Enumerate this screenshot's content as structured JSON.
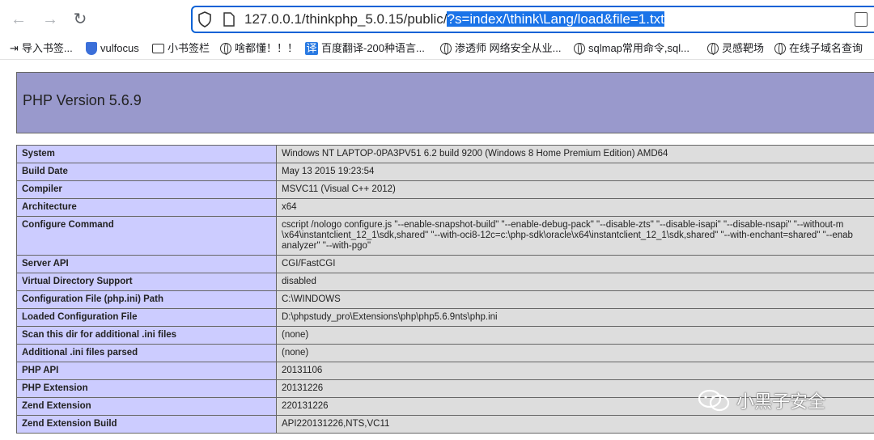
{
  "browser": {
    "url_plain": "127.0.0.1/thinkphp_5.0.15/public/",
    "url_selected": "?s=index/\\think\\Lang/load&file=1.txt"
  },
  "bookmarks": [
    {
      "label": "导入书签...",
      "icon": "import-icon"
    },
    {
      "label": "vulfocus",
      "icon": "shield-icon"
    },
    {
      "label": "小书签栏",
      "icon": "folder-icon"
    },
    {
      "label": "啥都懂！！！",
      "icon": "globe-icon"
    },
    {
      "label": "百度翻译-200种语言...",
      "icon": "translate-icon"
    },
    {
      "label": "渗透师 网络安全从业...",
      "icon": "globe-icon"
    },
    {
      "label": "sqlmap常用命令,sql...",
      "icon": "globe-icon"
    },
    {
      "label": "灵感靶场",
      "icon": "globe-icon"
    },
    {
      "label": "在线子域名查询",
      "icon": "globe-icon"
    }
  ],
  "phpinfo": {
    "title": "PHP Version 5.6.9",
    "rows": [
      {
        "key": "System",
        "value": "Windows NT LAPTOP-0PA3PV51 6.2 build 9200 (Windows 8 Home Premium Edition) AMD64"
      },
      {
        "key": "Build Date",
        "value": "May 13 2015 19:23:54"
      },
      {
        "key": "Compiler",
        "value": "MSVC11 (Visual C++ 2012)"
      },
      {
        "key": "Architecture",
        "value": "x64"
      },
      {
        "key": "Configure Command",
        "value_lines": [
          "cscript /nologo configure.js \"--enable-snapshot-build\" \"--enable-debug-pack\" \"--disable-zts\" \"--disable-isapi\" \"--disable-nsapi\" \"--without-m",
          "\\x64\\instantclient_12_1\\sdk,shared\" \"--with-oci8-12c=c:\\php-sdk\\oracle\\x64\\instantclient_12_1\\sdk,shared\" \"--with-enchant=shared\" \"--enab",
          "analyzer\" \"--with-pgo\""
        ]
      },
      {
        "key": "Server API",
        "value": "CGI/FastCGI"
      },
      {
        "key": "Virtual Directory Support",
        "value": "disabled"
      },
      {
        "key": "Configuration File (php.ini) Path",
        "value": "C:\\WINDOWS"
      },
      {
        "key": "Loaded Configuration File",
        "value": "D:\\phpstudy_pro\\Extensions\\php\\php5.6.9nts\\php.ini"
      },
      {
        "key": "Scan this dir for additional .ini files",
        "value": "(none)"
      },
      {
        "key": "Additional .ini files parsed",
        "value": "(none)"
      },
      {
        "key": "PHP API",
        "value": "20131106"
      },
      {
        "key": "PHP Extension",
        "value": "20131226"
      },
      {
        "key": "Zend Extension",
        "value": "220131226"
      },
      {
        "key": "Zend Extension Build",
        "value": "API220131226,NTS,VC11"
      }
    ]
  },
  "watermark": "小黑子安全",
  "colors": {
    "header_bg": "#9999cc",
    "key_bg": "#ccccff",
    "value_bg": "#dddddd",
    "selection": "#1a73e8"
  }
}
